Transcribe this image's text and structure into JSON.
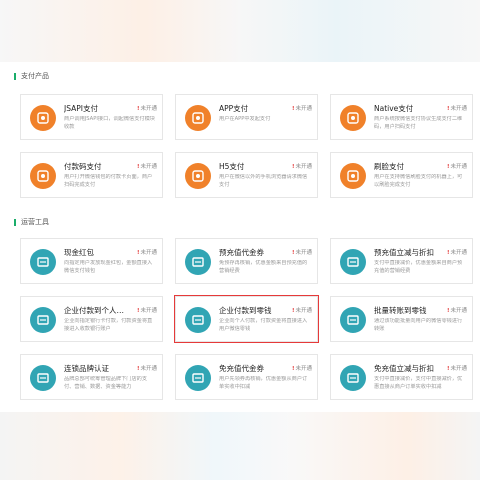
{
  "sections": {
    "payment_products": "支付产品",
    "operation_tools": "运营工具"
  },
  "status_label": "未开通",
  "cards": [
    {
      "title": "JSAPI支付",
      "desc": "商户调用JSAPI接口，调起微信支付模块收款",
      "icon": "user-pay-icon"
    },
    {
      "title": "APP支付",
      "desc": "用户在APP中发起支付",
      "icon": "phone-pay-icon"
    },
    {
      "title": "Native支付",
      "desc": "商户系统按微信支付协议生成支付二维码，用户扫码支付",
      "icon": "qr-code-icon"
    },
    {
      "title": "付款码支付",
      "desc": "用户打开微信钱包的付款卡页面，商户扫码完成支付",
      "icon": "scanner-icon"
    },
    {
      "title": "H5支付",
      "desc": "用户在微信以外的手机浏览器请求微信支付",
      "icon": "mobile-browser-icon"
    },
    {
      "title": "刷脸支付",
      "desc": "用户在支持微信刷脸支付的机器上，可以刷脸完成支付",
      "icon": "face-scan-icon"
    },
    {
      "title": "现金红包",
      "desc": "向指定用户发放现金红包，金额直接入微信支付钱包",
      "icon": "red-packet-icon"
    },
    {
      "title": "预充值代金券",
      "desc": "免预存再核销，优惠金额来自预充值的营销经费",
      "icon": "coupon-icon"
    },
    {
      "title": "预充值立减与折扣",
      "desc": "支付中直接减价，优惠金额来自商户预充值的营销经费",
      "icon": "discount-icon"
    },
    {
      "title": "企业付款到个人银行卡",
      "desc": "企业向指定银行卡付款，付款资金将直接进入收款银行账户",
      "icon": "bank-card-icon"
    },
    {
      "title": "企业付款到零钱",
      "desc": "企业向个人付款，付款资金将直接进入用户微信零钱",
      "icon": "wallet-transfer-icon"
    },
    {
      "title": "批量转账到零钱",
      "desc": "通过该功能批量向用户的微信零钱进行转账",
      "icon": "batch-transfer-icon"
    },
    {
      "title": "连锁品牌认证",
      "desc": "品牌总部可统筹管理品牌下门店的支付、营销、数据、资金等能力",
      "icon": "brand-chain-icon"
    },
    {
      "title": "免充值代金券",
      "desc": "用户先领券再核销，优惠金额从商户订单实收中扣减",
      "icon": "coupon-free-icon"
    },
    {
      "title": "免充值立减与折扣",
      "desc": "支付中直接减价，支付中直接减价，优惠直接从商户订单实收中扣减",
      "icon": "discount-free-icon"
    }
  ],
  "colors": {
    "orange": "#f0812a",
    "teal": "#31a5b4",
    "status_red": "#e23b3b",
    "highlight": "#e63a3a",
    "accent_green": "#1aad6a"
  }
}
